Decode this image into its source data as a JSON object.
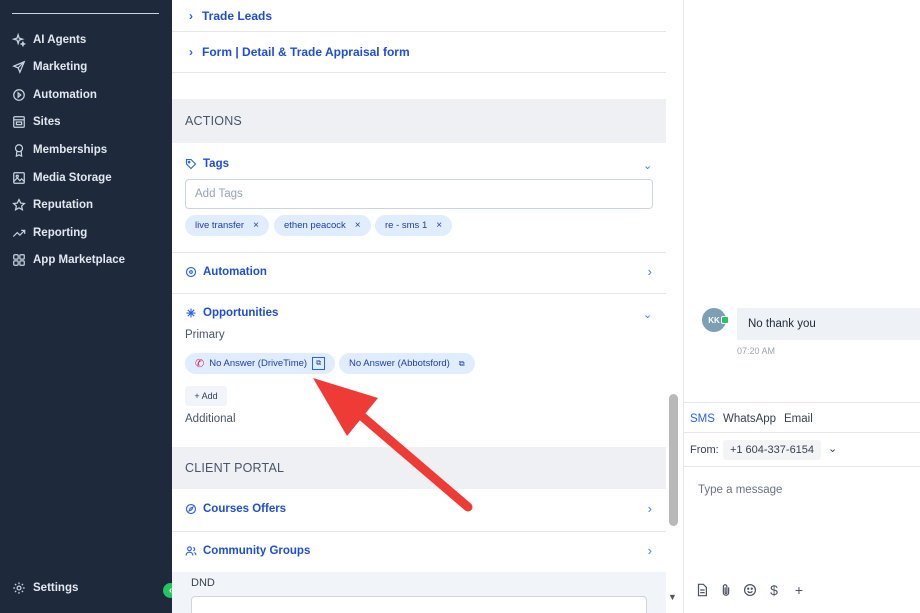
{
  "sidebar": {
    "items": [
      {
        "label": "AI Agents",
        "icon": "sparkle-icon"
      },
      {
        "label": "Marketing",
        "icon": "send-icon"
      },
      {
        "label": "Automation",
        "icon": "automation-icon"
      },
      {
        "label": "Sites",
        "icon": "sites-icon"
      },
      {
        "label": "Memberships",
        "icon": "award-icon"
      },
      {
        "label": "Media Storage",
        "icon": "image-icon"
      },
      {
        "label": "Reputation",
        "icon": "star-icon"
      },
      {
        "label": "Reporting",
        "icon": "trend-icon"
      },
      {
        "label": "App Marketplace",
        "icon": "grid-icon"
      }
    ],
    "settings_label": "Settings",
    "collapse_glyph": "‹"
  },
  "forms": {
    "trade_leads": "Trade Leads",
    "appraisal": "Form | Detail & Trade Appraisal form"
  },
  "actions": {
    "heading": "ACTIONS",
    "tags_label": "Tags",
    "tags_placeholder": "Add Tags",
    "tags": [
      "live transfer",
      "ethen peacock",
      "re - sms 1"
    ],
    "automation_label": "Automation",
    "opportunities_label": "Opportunities",
    "primary_label": "Primary",
    "opportunities": [
      "No Answer (DriveTime)",
      "No Answer (Abbotsford)"
    ],
    "add_label": "+ Add",
    "additional_label": "Additional"
  },
  "client_portal": {
    "heading": "CLIENT PORTAL",
    "courses_label": "Courses Offers",
    "community_label": "Community Groups",
    "dnd_label": "DND"
  },
  "conversation": {
    "avatar_initials": "KK",
    "message": "No thank you",
    "time": "07:20 AM",
    "channels": [
      "SMS",
      "WhatsApp",
      "Email"
    ],
    "active_channel": "SMS",
    "from_label": "From:",
    "from_number": "+1 604-337-6154",
    "input_placeholder": "Type a message"
  },
  "colors": {
    "sidebar_bg": "#1e293b",
    "accent": "#2563eb",
    "pill_bg": "#e0edff",
    "arrow": "#ef3b36"
  }
}
